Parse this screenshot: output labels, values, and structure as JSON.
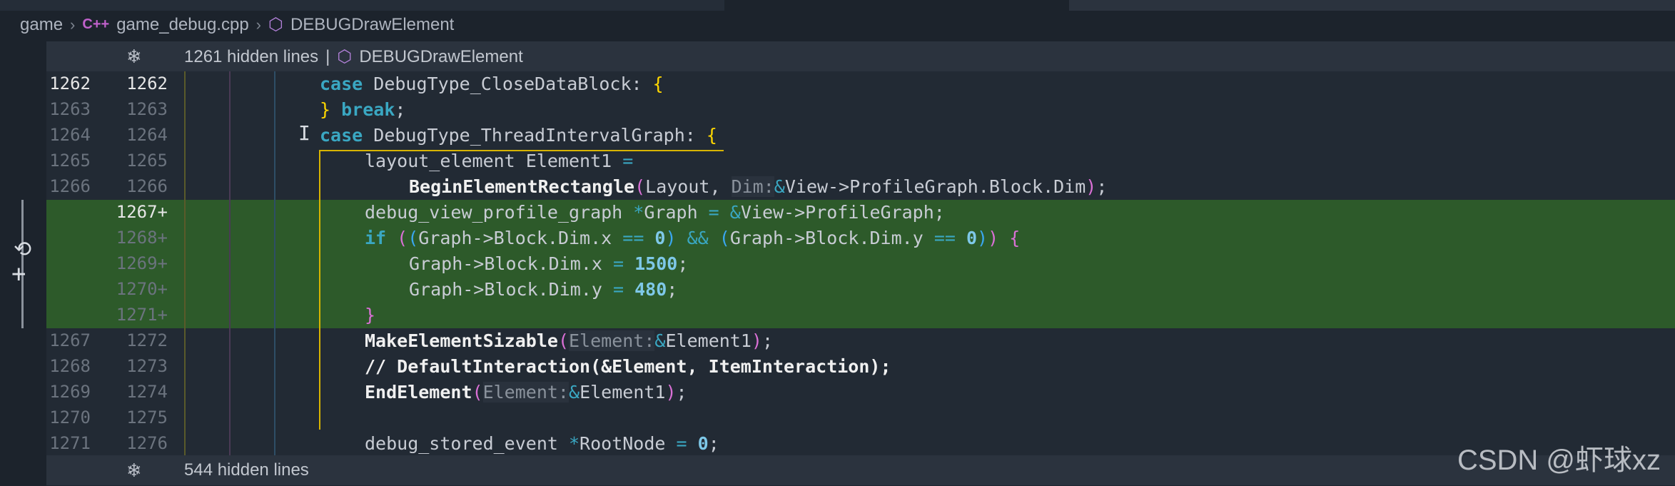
{
  "breadcrumb": {
    "folder": "game",
    "cpp_icon_text": "C++",
    "file": "game_debug.cpp",
    "symbol": "DEBUGDrawElement"
  },
  "hidden_top": {
    "text": "1261 hidden lines",
    "separator": "|",
    "symbol": "DEBUGDrawElement"
  },
  "hidden_bottom": {
    "text": "544 hidden lines"
  },
  "lines": [
    {
      "old": "1262",
      "new": "1262",
      "added": false,
      "current": true
    },
    {
      "old": "1263",
      "new": "1263",
      "added": false
    },
    {
      "old": "1264",
      "new": "1264",
      "added": false
    },
    {
      "old": "1265",
      "new": "1265",
      "added": false
    },
    {
      "old": "1266",
      "new": "1266",
      "added": false
    },
    {
      "old": "",
      "new": "1267+",
      "added": true,
      "current": true
    },
    {
      "old": "",
      "new": "1268+",
      "added": true
    },
    {
      "old": "",
      "new": "1269+",
      "added": true
    },
    {
      "old": "",
      "new": "1270+",
      "added": true
    },
    {
      "old": "",
      "new": "1271+",
      "added": true
    },
    {
      "old": "1267",
      "new": "1272",
      "added": false
    },
    {
      "old": "1268",
      "new": "1273",
      "added": false
    },
    {
      "old": "1269",
      "new": "1274",
      "added": false
    },
    {
      "old": "1270",
      "new": "1275",
      "added": false
    },
    {
      "old": "1271",
      "new": "1276",
      "added": false
    }
  ],
  "code": {
    "l1_kw": "case",
    "l1_rest": " DebugType_CloseDataBlock: ",
    "l1_brace": "{",
    "l2_brace": "}",
    "l2_kw": " break",
    "l2_semi": ";",
    "l3_kw": "case",
    "l3_rest": " DebugType_ThreadIntervalGraph: ",
    "l3_brace": "{",
    "l4_text": "layout_element Element1 ",
    "l4_eq": "=",
    "l5_fn": "BeginElementRectangle",
    "l5_p1": "(",
    "l5_a": "Layout, ",
    "l5_hint": "Dim:",
    "l5_amp": "&",
    "l5_b": "View->ProfileGraph.Block.Dim",
    "l5_p2": ")",
    "l5_semi": ";",
    "l6_a": "debug_view_profile_graph ",
    "l6_star": "*",
    "l6_b": "Graph ",
    "l6_eq": "=",
    "l6_amp": " &",
    "l6_c": "View->ProfileGraph;",
    "l7_kw": "if",
    "l7_p1": " (",
    "l7_p2": "(",
    "l7_a": "Graph->Block.Dim.x ",
    "l7_eq": "==",
    "l7_num": " 0",
    "l7_p3": ")",
    "l7_and": " && ",
    "l7_p4": "(",
    "l7_b": "Graph->Block.Dim.y ",
    "l7_eq2": "==",
    "l7_num2": " 0",
    "l7_p5": ")",
    "l7_p6": ")",
    "l7_brace": " {",
    "l8_a": "Graph->Block.Dim.x ",
    "l8_eq": "=",
    "l8_num": " 1500",
    "l8_semi": ";",
    "l9_a": "Graph->Block.Dim.y ",
    "l9_eq": "=",
    "l9_num": " 480",
    "l9_semi": ";",
    "l10_brace": "}",
    "l11_fn": "MakeElementSizable",
    "l11_p1": "(",
    "l11_hint": "Element:",
    "l11_amp": "&",
    "l11_b": "Element1",
    "l11_p2": ")",
    "l11_semi": ";",
    "l12_text": "// DefaultInteraction(&Element, ItemInteraction);",
    "l13_fn": "EndElement",
    "l13_p1": "(",
    "l13_hint": "Element:",
    "l13_amp": "&",
    "l13_b": "Element1",
    "l13_p2": ")",
    "l13_semi": ";",
    "l15_a": "debug_stored_event ",
    "l15_star": "*",
    "l15_b": "RootNode ",
    "l15_eq": "=",
    "l15_num": " 0",
    "l15_semi": ";"
  },
  "gutter": {
    "revert_icon": "undo-icon",
    "add_icon": "plus-icon"
  },
  "watermark": "CSDN @虾球xz",
  "colors": {
    "background": "#222a34",
    "added_line": "#2d5a2a",
    "keyword": "#3aa7c2",
    "bracket_gold": "#ffd700",
    "bracket_purple": "#da70d6",
    "bracket_blue": "#3aa7f0"
  }
}
